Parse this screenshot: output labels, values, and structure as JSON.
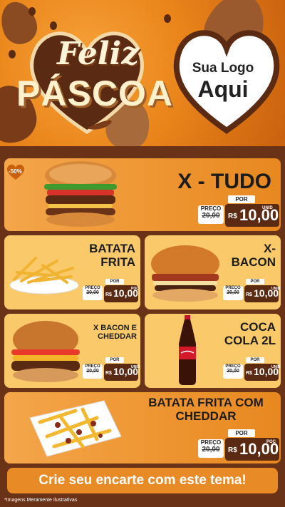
{
  "header": {
    "title_line1": "Feliz",
    "title_line2": "PÁSCOA",
    "logo_line1": "Sua Logo",
    "logo_line2": "Aqui"
  },
  "discount_badge": "-50%",
  "products": [
    {
      "name": "X - TUDO",
      "por_label": "POR",
      "preco_label": "PREÇO",
      "old_price": "20,00",
      "old_prefix": "R$",
      "currency": "R$",
      "new_price": "10,00",
      "unit_label": "UNID"
    },
    {
      "name": "BATATA FRITA",
      "por_label": "POR",
      "preco_label": "PREÇO",
      "old_price": "20,00",
      "old_prefix": "R$",
      "currency": "R$",
      "new_price": "10,00",
      "unit_label": "POÇ"
    },
    {
      "name": "X- BACON",
      "por_label": "POR",
      "preco_label": "PREÇO",
      "old_price": "20,00",
      "old_prefix": "R$",
      "currency": "R$",
      "new_price": "10,00",
      "unit_label": "UNID"
    },
    {
      "name": "X BACON E CHEDDAR",
      "por_label": "POR",
      "preco_label": "PREÇO",
      "old_price": "20,00",
      "old_prefix": "R$",
      "currency": "R$",
      "new_price": "10,00",
      "unit_label": "UNID"
    },
    {
      "name": "COCA COLA 2L",
      "por_label": "POR",
      "preco_label": "PREÇO",
      "old_price": "20,00",
      "old_prefix": "R$",
      "currency": "R$",
      "new_price": "10,00",
      "unit_label": "UNID"
    },
    {
      "name": "BATATA FRITA COM CHEDDAR",
      "por_label": "POR",
      "preco_label": "PREÇO",
      "old_price": "20,00",
      "old_prefix": "R$",
      "currency": "R$",
      "new_price": "10,00",
      "unit_label": "POÇ"
    }
  ],
  "cta": "Crie seu encarte com este tema!",
  "disclaimer": "*Imagens Meramente Ilustrativas",
  "colors": {
    "orange": "#e8881f",
    "chocolate": "#5a2a12",
    "cream": "#f9c96a",
    "accent": "#e88a26"
  }
}
